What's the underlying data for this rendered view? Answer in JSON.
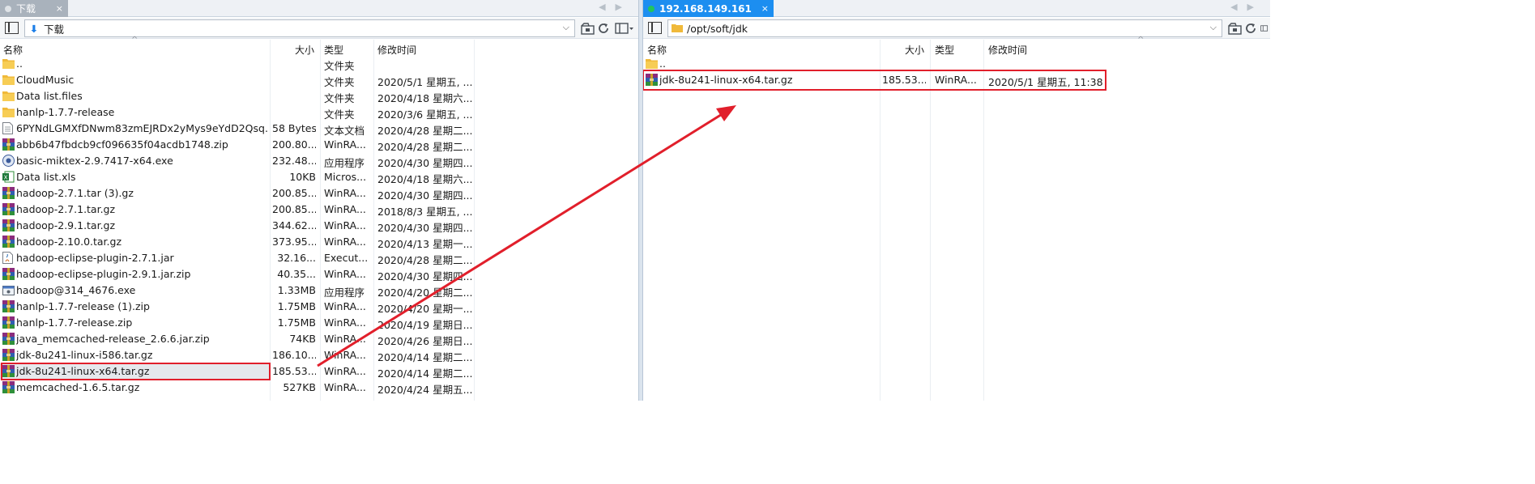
{
  "local": {
    "tab_label": "下载",
    "tab_close": "×",
    "path": "下载",
    "columns": {
      "name": "名称",
      "size": "大小",
      "type": "类型",
      "modified": "修改时间"
    },
    "rows": [
      {
        "name": "..",
        "size": "",
        "type": "文件夹",
        "modified": "",
        "icon": "folder-icon"
      },
      {
        "name": "CloudMusic",
        "size": "",
        "type": "文件夹",
        "modified": "2020/5/1 星期五, ...",
        "icon": "folder-icon"
      },
      {
        "name": "Data list.files",
        "size": "",
        "type": "文件夹",
        "modified": "2020/4/18 星期六...",
        "icon": "folder-icon"
      },
      {
        "name": "hanlp-1.7.7-release",
        "size": "",
        "type": "文件夹",
        "modified": "2020/3/6 星期五, ...",
        "icon": "folder-icon"
      },
      {
        "name": "6PYNdLGMXfDNwm83zmEJRDx2yMys9eYdD2Qsq...",
        "size": "58 Bytes",
        "type": "文本文档",
        "modified": "2020/4/28 星期二...",
        "icon": "text-file-icon"
      },
      {
        "name": "abb6b47fbdcb9cf096635f04acdb1748.zip",
        "size": "200.80...",
        "type": "WinRA...",
        "modified": "2020/4/28 星期二...",
        "icon": "archive-icon"
      },
      {
        "name": "basic-miktex-2.9.7417-x64.exe",
        "size": "232.48...",
        "type": "应用程序",
        "modified": "2020/4/30 星期四...",
        "icon": "installer-icon"
      },
      {
        "name": "Data list.xls",
        "size": "10KB",
        "type": "Micros...",
        "modified": "2020/4/18 星期六...",
        "icon": "spreadsheet-icon"
      },
      {
        "name": "hadoop-2.7.1.tar (3).gz",
        "size": "200.85...",
        "type": "WinRA...",
        "modified": "2020/4/30 星期四...",
        "icon": "archive-icon"
      },
      {
        "name": "hadoop-2.7.1.tar.gz",
        "size": "200.85...",
        "type": "WinRA...",
        "modified": "2018/8/3 星期五, ...",
        "icon": "archive-icon"
      },
      {
        "name": "hadoop-2.9.1.tar.gz",
        "size": "344.62...",
        "type": "WinRA...",
        "modified": "2020/4/30 星期四...",
        "icon": "archive-icon"
      },
      {
        "name": "hadoop-2.10.0.tar.gz",
        "size": "373.95...",
        "type": "WinRA...",
        "modified": "2020/4/13 星期一...",
        "icon": "archive-icon"
      },
      {
        "name": "hadoop-eclipse-plugin-2.7.1.jar",
        "size": "32.16...",
        "type": "Execut...",
        "modified": "2020/4/28 星期二...",
        "icon": "jar-icon"
      },
      {
        "name": "hadoop-eclipse-plugin-2.9.1.jar.zip",
        "size": "40.35...",
        "type": "WinRA...",
        "modified": "2020/4/30 星期四...",
        "icon": "archive-icon"
      },
      {
        "name": "hadoop@314_4676.exe",
        "size": "1.33MB",
        "type": "应用程序",
        "modified": "2020/4/20 星期二...",
        "icon": "exe-icon"
      },
      {
        "name": "hanlp-1.7.7-release (1).zip",
        "size": "1.75MB",
        "type": "WinRA...",
        "modified": "2020/4/20 星期一...",
        "icon": "archive-icon"
      },
      {
        "name": "hanlp-1.7.7-release.zip",
        "size": "1.75MB",
        "type": "WinRA...",
        "modified": "2020/4/19 星期日...",
        "icon": "archive-icon"
      },
      {
        "name": "java_memcached-release_2.6.6.jar.zip",
        "size": "74KB",
        "type": "WinRA...",
        "modified": "2020/4/26 星期日...",
        "icon": "archive-icon"
      },
      {
        "name": "jdk-8u241-linux-i586.tar.gz",
        "size": "186.10...",
        "type": "WinRA...",
        "modified": "2020/4/14 星期二...",
        "icon": "archive-icon"
      },
      {
        "name": "jdk-8u241-linux-x64.tar.gz",
        "size": "185.53...",
        "type": "WinRA...",
        "modified": "2020/4/14 星期二...",
        "icon": "archive-icon",
        "selected": true
      },
      {
        "name": "memcached-1.6.5.tar.gz",
        "size": "527KB",
        "type": "WinRA...",
        "modified": "2020/4/24 星期五...",
        "icon": "archive-icon"
      }
    ]
  },
  "remote": {
    "tab_label": "192.168.149.161",
    "tab_close": "×",
    "path": "/opt/soft/jdk",
    "columns": {
      "name": "名称",
      "size": "大小",
      "type": "类型",
      "modified": "修改时间"
    },
    "rows": [
      {
        "name": "..",
        "size": "",
        "type": "",
        "modified": "",
        "icon": "folder-icon"
      },
      {
        "name": "jdk-8u241-linux-x64.tar.gz",
        "size": "185.53...",
        "type": "WinRA...",
        "modified": "2020/5/1 星期五, 11:38",
        "icon": "archive-icon",
        "selected": true
      }
    ]
  },
  "colors": {
    "highlight": "#e11f2b",
    "remote_tab": "#1c8ef0",
    "local_tab": "#a9b2bc",
    "connected_dot": "#22c55e"
  }
}
